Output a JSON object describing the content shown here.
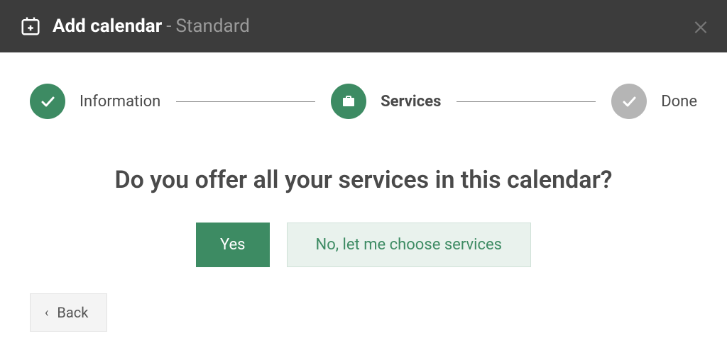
{
  "header": {
    "title": "Add calendar",
    "separator": " - ",
    "subtitle": "Standard"
  },
  "stepper": {
    "steps": [
      {
        "label": "Information"
      },
      {
        "label": "Services"
      },
      {
        "label": "Done"
      }
    ]
  },
  "question": "Do you offer all your services in this calendar?",
  "buttons": {
    "yes": "Yes",
    "no": "No, let me choose services",
    "back": "Back"
  },
  "colors": {
    "accent": "#3d8b63",
    "header_bg": "#3c3c3c"
  }
}
